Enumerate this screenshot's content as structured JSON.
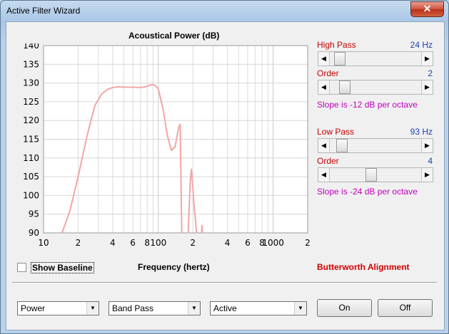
{
  "window": {
    "title": "Active Filter Wizard",
    "close_glyph": "✕"
  },
  "chart_data": {
    "type": "line",
    "title": "Acoustical Power (dB)",
    "xlabel": "Frequency (hertz)",
    "ylabel": "",
    "x_scale": "log",
    "xlim": [
      10,
      2000
    ],
    "ylim": [
      90,
      140
    ],
    "grid": true,
    "y_ticks": [
      "140",
      "135",
      "130",
      "125",
      "120",
      "115",
      "110",
      "105",
      "100",
      "95",
      "90"
    ],
    "x_ticks": [
      "10",
      "2",
      "4",
      "6",
      "8",
      "100",
      "2",
      "4",
      "6",
      "8",
      "1000",
      "2"
    ],
    "series": [
      {
        "color": "#f2a6a6",
        "x": [
          14.5,
          17,
          20,
          24,
          28,
          32,
          36,
          40,
          45,
          50,
          60,
          70,
          80,
          85,
          90,
          95,
          100,
          110,
          120,
          130,
          140,
          150,
          155,
          160
        ],
        "y": [
          90,
          96,
          105,
          116,
          124,
          127,
          128.3,
          128.8,
          129.0,
          128.9,
          128.9,
          128.8,
          129.1,
          129.5,
          129.6,
          129.2,
          128.4,
          123,
          116,
          112,
          113,
          118,
          119,
          90
        ]
      },
      {
        "color": "#f2a6a6",
        "x": [
          182,
          186,
          190,
          194,
          200,
          206,
          210,
          215
        ],
        "y": [
          90,
          97,
          104,
          107,
          102,
          96,
          94,
          90
        ]
      },
      {
        "color": "#f2a6a6",
        "x": [
          238,
          240,
          242
        ],
        "y": [
          90,
          92,
          90
        ]
      }
    ]
  },
  "high_pass": {
    "label": "High Pass",
    "value": "24 Hz",
    "order_label": "Order",
    "order_value": "2",
    "slope_text": "Slope is -12 dB per octave",
    "freq_level": 0.05,
    "order_level": 0.12
  },
  "low_pass": {
    "label": "Low Pass",
    "value": "93 Hz",
    "order_label": "Order",
    "order_value": "4",
    "slope_text": "Slope is -24 dB per octave",
    "freq_level": 0.08,
    "order_level": 0.45
  },
  "show_baseline_label": "Show Baseline",
  "alignment_text": "Butterworth Alignment",
  "combos": {
    "mode": "Power",
    "filter_type": "Band Pass",
    "circuit": "Active"
  },
  "buttons": {
    "on": "On",
    "off": "Off"
  },
  "icons": {
    "arrow_left": "◀",
    "arrow_right": "▶",
    "dropdown": "▼"
  }
}
